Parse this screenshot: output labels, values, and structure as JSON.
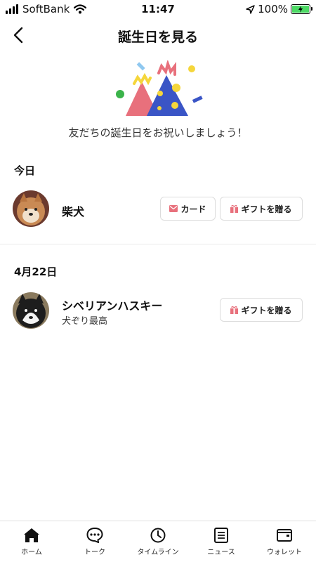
{
  "status_bar": {
    "carrier": "SoftBank",
    "time": "11:47",
    "battery": "100%"
  },
  "header": {
    "title": "誕生日を見る"
  },
  "hero": {
    "message": "友だちの誕生日をお祝いしましょう！"
  },
  "sections": [
    {
      "title": "今日",
      "friends": [
        {
          "name": "柴犬",
          "status": "",
          "card_label": "カード",
          "gift_label": "ギフトを贈る"
        }
      ]
    },
    {
      "title": "4月22日",
      "friends": [
        {
          "name": "シベリアンハスキー",
          "status": "犬ぞり最高",
          "gift_label": "ギフトを贈る"
        }
      ]
    }
  ],
  "tabbar": {
    "items": [
      {
        "label": "ホーム",
        "icon": "home-icon"
      },
      {
        "label": "トーク",
        "icon": "chat-icon"
      },
      {
        "label": "タイムライン",
        "icon": "clock-icon"
      },
      {
        "label": "ニュース",
        "icon": "news-icon"
      },
      {
        "label": "ウォレット",
        "icon": "wallet-icon"
      }
    ]
  },
  "colors": {
    "accent_pink": "#e8707c",
    "hat_blue": "#3a55c6",
    "hat_yellow": "#f5d63b",
    "battery_green": "#4cd964"
  }
}
